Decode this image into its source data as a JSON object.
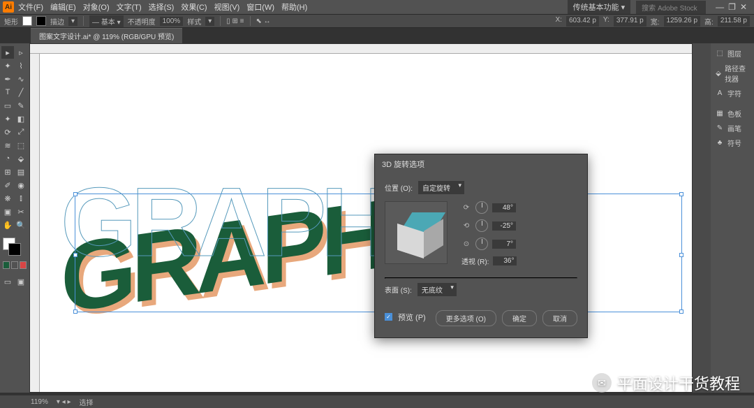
{
  "app_logo": "Ai",
  "menu": [
    "文件(F)",
    "编辑(E)",
    "对象(O)",
    "文字(T)",
    "选择(S)",
    "效果(C)",
    "视图(V)",
    "窗口(W)",
    "帮助(H)"
  ],
  "workspace": "传统基本功能",
  "search_placeholder": "搜索 Adobe Stock",
  "window_buttons": [
    "—",
    "❐",
    "✕"
  ],
  "controlbar": {
    "label_left": "矩形",
    "stroke_label": "描边",
    "stroke_pt": "",
    "basic": "基本",
    "opacity_label": "不透明度",
    "opacity_val": "100%",
    "style_label": "样式",
    "x_val": "603.42 p",
    "y_val": "377.91 p",
    "w_val": "1259.26 p",
    "h_val": "211.58 p"
  },
  "tab": "图案文字设计.ai* @ 119% (RGB/GPU 预览)",
  "artwork_text": "GRAPHIC",
  "right_panels": {
    "groups": [
      [
        "图层",
        "路径查找器",
        "字符"
      ],
      [
        "色板",
        "画笔",
        "符号"
      ]
    ],
    "icons": [
      "⬚",
      "⬙",
      "A",
      "▦",
      "✎",
      "♣"
    ]
  },
  "dialog": {
    "title": "3D 旋转选项",
    "position_label": "位置 (O):",
    "position_value": "自定旋转",
    "angles": [
      {
        "icon": "⟳",
        "value": "48°"
      },
      {
        "icon": "⟲",
        "value": "-25°"
      },
      {
        "icon": "⊙",
        "value": "7°"
      }
    ],
    "perspective_label": "透视 (R):",
    "perspective_value": "36°",
    "surface_label": "表面 (S):",
    "surface_value": "无底纹",
    "preview_label": "预览 (P)",
    "buttons": [
      "更多选项 (O)",
      "确定",
      "取消"
    ]
  },
  "status": {
    "zoom": "119%",
    "mode": "选择"
  },
  "watermark": "平面设计干货教程"
}
